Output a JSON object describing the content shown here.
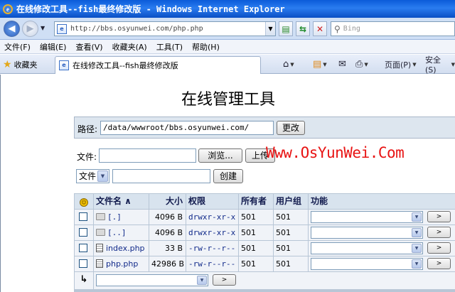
{
  "window": {
    "title": "在线修改工具--fish最终修改版 - Windows Internet Explorer"
  },
  "address_bar": {
    "url": "http://bbs.osyunwei.com/php.php",
    "search_placeholder": "Bing"
  },
  "menu": [
    "文件(F)",
    "编辑(E)",
    "查看(V)",
    "收藏夹(A)",
    "工具(T)",
    "帮助(H)"
  ],
  "tabs": {
    "favorites_label": "收藏夹",
    "active_tab_title": "在线修改工具--fish最终修改版",
    "page_menu": "页面(P)",
    "safety_menu": "安全(S)"
  },
  "page": {
    "title": "在线管理工具",
    "path_label": "路径:",
    "path_value": "/data/wwwroot/bbs.osyunwei.com/",
    "change_button": "更改",
    "file_label": "文件:",
    "browse_button": "浏览...",
    "upload_button": "上传",
    "type_select": "文件",
    "create_button": "创建",
    "watermark": "Www.OsYunWei.Com"
  },
  "table": {
    "headers": {
      "name": "文件名 ∧",
      "size": "大小",
      "perms": "权限",
      "owner": "所有者",
      "group": "用户组",
      "actions": "功能"
    },
    "rows": [
      {
        "type": "folder",
        "name": "[.]",
        "size": "4096 B",
        "perms": "drwxr-xr-x",
        "owner": "501",
        "group": "501"
      },
      {
        "type": "folder",
        "name": "[..]",
        "size": "4096 B",
        "perms": "drwxr-xr-x",
        "owner": "501",
        "group": "501"
      },
      {
        "type": "file",
        "name": "index.php",
        "size": "33 B",
        "perms": "-rw-r--r--",
        "owner": "501",
        "group": "501"
      },
      {
        "type": "file",
        "name": "php.php",
        "size": "42986 B",
        "perms": "-rw-r--r--",
        "owner": "501",
        "group": "501"
      }
    ],
    "go_button": ">",
    "bottom_arrow": "↳"
  },
  "colors": {
    "titlebar": "#0b5bd9",
    "watermark": "#e81313",
    "table_header": "#d8e3ee",
    "table_cell": "#f0f3f8"
  }
}
